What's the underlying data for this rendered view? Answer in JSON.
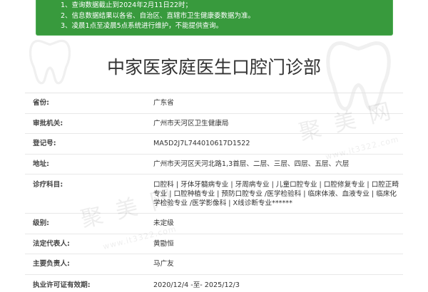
{
  "notice": {
    "lines": [
      "1、查询数据截止到2024年2月11日22时；",
      "2、信息数据结果以各省、自治区、直辖市卫生健康委数据为准。",
      "3、凌晨1点至凌晨5点系统进行维护，不能提供查询。"
    ]
  },
  "title": "中家医家庭医生口腔门诊部",
  "details": [
    {
      "label": "省份:",
      "value": "广东省"
    },
    {
      "label": "审批机关:",
      "value": "广州市天河区卫生健康局"
    },
    {
      "label": "登记号:",
      "value": "MA5D2J7L744010617D1522"
    },
    {
      "label": "地址:",
      "value": "广州市天河区天河北路1,3首层、二层、三层、四层、五层、六层"
    },
    {
      "label": "诊疗科目:",
      "value": "口腔科 | 牙体牙髓病专业 | 牙周病专业 | 儿童口腔专业 | 口腔修复专业 | 口腔正畸专业 | 口腔种植专业 | 预防口腔专业 /医学检验科 | 临床体液、血液专业 | 临床化学检验专业 /医学影像科 | X线诊断专业******"
    },
    {
      "label": "级别:",
      "value": "未定级"
    },
    {
      "label": "法定代表人:",
      "value": "黄勖恒"
    },
    {
      "label": "主要负责人:",
      "value": "马广友"
    },
    {
      "label": "执业许可证有效期:",
      "value": "2020/12/4 -至- 2025/12/3"
    }
  ],
  "watermark": {
    "brand": "聚美网",
    "url": "www.it3322.com"
  },
  "icons": {
    "background_mark": "tooth-icon"
  },
  "colors": {
    "notice_bg": "#389a3d",
    "notice_text": "#ffffff",
    "text": "#333333",
    "divider": "#e8e8e8"
  }
}
